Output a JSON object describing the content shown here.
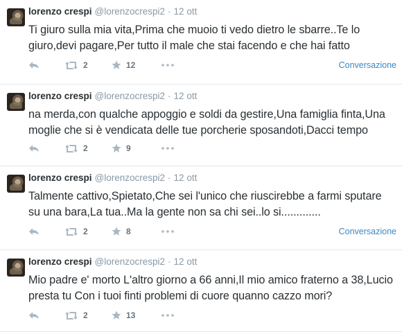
{
  "tweets": [
    {
      "fullname": "lorenzo crespi",
      "username": "@lorenzocrespi2",
      "separator": "·",
      "time": "12 ott",
      "lines": [
        "Ti giuro sulla mia vita,Prima che muoio ti vedo dietro le sbarre..Te lo",
        "giuro,devi pagare,Per tutto il male che stai facendo e che hai fatto"
      ],
      "retweets": "2",
      "favorites": "12",
      "conversation": "Conversazione"
    },
    {
      "fullname": "lorenzo crespi",
      "username": "@lorenzocrespi2",
      "separator": "·",
      "time": "12 ott",
      "lines": [
        "na merda,con qualche appoggio e soldi da gestire,Una famiglia finta,Una",
        "moglie che si è vendicata delle tue porcherie sposandoti,Dacci tempo"
      ],
      "retweets": "2",
      "favorites": "9",
      "conversation": ""
    },
    {
      "fullname": "lorenzo crespi",
      "username": "@lorenzocrespi2",
      "separator": "·",
      "time": "12 ott",
      "lines": [
        "Talmente cattivo,Spietato,Che sei l'unico che riuscirebbe a farmi sputare",
        "su una bara,La tua..Ma la gente non sa chi sei..lo si............."
      ],
      "retweets": "2",
      "favorites": "8",
      "conversation": "Conversazione"
    },
    {
      "fullname": "lorenzo crespi",
      "username": "@lorenzocrespi2",
      "separator": "·",
      "time": "12 ott",
      "lines": [
        "Mio padre e' morto L'altro giorno a 66 anni,Il mio amico fraterno a 38,Lucio",
        "presta tu Con i tuoi finti problemi di cuore quanno cazzo mori?"
      ],
      "retweets": "2",
      "favorites": "13",
      "conversation": ""
    }
  ],
  "icons": {
    "reply": "reply-icon",
    "retweet": "retweet-icon",
    "favorite": "star-icon",
    "more": "more-dots-icon"
  },
  "colors": {
    "text": "#292f33",
    "muted": "#8899a6",
    "link": "#3b88c3",
    "divider": "#e1e8ed"
  }
}
